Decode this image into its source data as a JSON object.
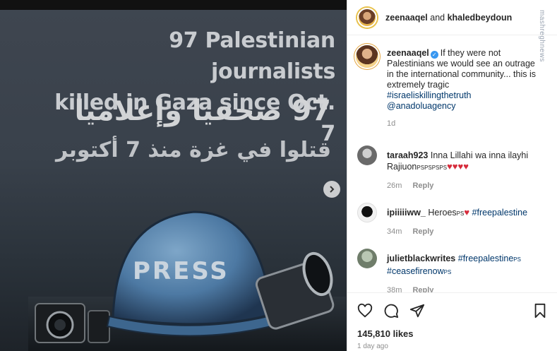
{
  "image": {
    "headline_en_line1": "97 Palestinian journalists",
    "headline_en_line2": "killed in Gaza since Oct. 7",
    "headline_ar_line1": "97 صحفيا وإعلاميا",
    "headline_ar_line2": "قتلوا في غزة منذ 7 أكتوبر",
    "helmet_label": "PRESS",
    "next_icon": "chevron-right-icon"
  },
  "header": {
    "user1": "zeenaaqel",
    "joiner": " and ",
    "user2": "khaledbeydoun"
  },
  "watermark_text": "mashreghnews",
  "caption": {
    "username": "zeenaaqel",
    "text": "If they were not Palestinians we would see an outrage in the international community... this is extremely tragic",
    "hashtag": "#israeliskillingthetruth",
    "mention": "@anadoluagency",
    "time": "1d"
  },
  "comments": [
    {
      "username": "taraah923",
      "text": "Inna Lillahi wa inna ilayhi Rajiuon",
      "suffix": "PSPSPSPS",
      "hearts": "♥♥♥♥",
      "time": "26m",
      "reply": "Reply"
    },
    {
      "username": "ipiiiiiww_",
      "text": "Heroes",
      "suffix": "PS",
      "hearts": "♥",
      "hashtag": "#freepalestine",
      "time": "34m",
      "reply": "Reply"
    },
    {
      "username": "julietblackwrites",
      "hashtag1": "#freepalestine",
      "suffix1": "PS",
      "hashtag2": "#ceasefirenow",
      "suffix2": "PS",
      "time": "38m",
      "reply": "Reply"
    }
  ],
  "actions": {
    "likes": "145,810 likes",
    "ago": "1 day ago"
  },
  "colors": {
    "link": "#00376b",
    "heart": "#d62b3b",
    "verified": "#3897f0"
  }
}
